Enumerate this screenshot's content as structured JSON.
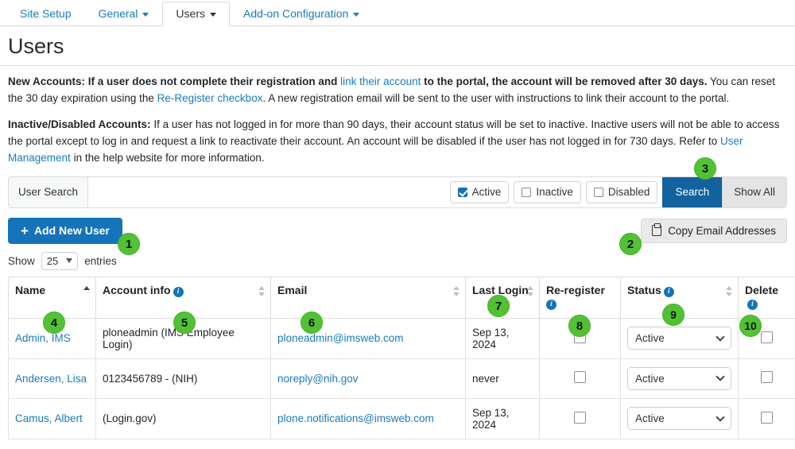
{
  "tabs": [
    {
      "label": "Site Setup",
      "has_caret": false,
      "active": false
    },
    {
      "label": "General",
      "has_caret": true,
      "active": false
    },
    {
      "label": "Users",
      "has_caret": true,
      "active": true
    },
    {
      "label": "Add-on Configuration",
      "has_caret": true,
      "active": false
    }
  ],
  "page": {
    "title": "Users"
  },
  "info": {
    "new_accounts": {
      "lead": "New Accounts:",
      "t1": " If a user does not complete their registration and ",
      "link1": "link their account",
      "t2": " to the portal, the account will be removed after 30 days.",
      "t3": " You can reset the 30 day expiration using the ",
      "link2": "Re-Register checkbox",
      "t4": ". A new registration email will be sent to the user with instructions to link their account to the portal."
    },
    "inactive_accounts": {
      "lead": "Inactive/Disabled Accounts:",
      "t1": " If a user has not logged in for more than 90 days, their account status will be set to inactive. Inactive users will not be able to access the portal except to log in and request a link to reactivate their account. An account will be disabled if the user has not logged in for 730 days. Refer to ",
      "link1": "User Management",
      "t2": " in the help website for more information."
    }
  },
  "search": {
    "label": "User Search",
    "value": "",
    "placeholder": "",
    "filters": [
      {
        "label": "Active",
        "checked": true
      },
      {
        "label": "Inactive",
        "checked": false
      },
      {
        "label": "Disabled",
        "checked": false
      }
    ],
    "search_button": "Search",
    "show_all_button": "Show All"
  },
  "actions": {
    "add_user": "Add New User",
    "add_user_plus": "+",
    "copy_emails": "Copy Email Addresses"
  },
  "show_entries": {
    "prefix": "Show",
    "value": "25",
    "suffix": "entries"
  },
  "table": {
    "columns": [
      {
        "label": "Name",
        "sort": "asc",
        "info": false
      },
      {
        "label": "Account info",
        "sort": "none",
        "info": true
      },
      {
        "label": "Email",
        "sort": "none",
        "info": false
      },
      {
        "label": "Last Login",
        "sort": "none",
        "info": false
      },
      {
        "label": "Re-register",
        "sort": "none",
        "info": true
      },
      {
        "label": "Status",
        "sort": "none",
        "info": true
      },
      {
        "label": "Delete",
        "sort": "none",
        "info": true
      }
    ],
    "rows": [
      {
        "name": "Admin, IMS",
        "account_info": "ploneadmin (IMS Employee Login)",
        "email": "ploneadmin@imsweb.com",
        "last_login": "Sep 13, 2024",
        "reregister": false,
        "status": "Active",
        "delete": false
      },
      {
        "name": "Andersen, Lisa",
        "account_info": "0123456789 - (NIH)",
        "email": "noreply@nih.gov",
        "last_login": "never",
        "reregister": false,
        "status": "Active",
        "delete": false
      },
      {
        "name": "Camus, Albert",
        "account_info": "(Login.gov)",
        "email": "plone.notifications@imsweb.com",
        "last_login": "Sep 13, 2024",
        "reregister": false,
        "status": "Active",
        "delete": false
      }
    ]
  },
  "badges": [
    {
      "n": "1"
    },
    {
      "n": "2"
    },
    {
      "n": "3"
    },
    {
      "n": "4"
    },
    {
      "n": "5"
    },
    {
      "n": "6"
    },
    {
      "n": "7"
    },
    {
      "n": "8"
    },
    {
      "n": "9"
    },
    {
      "n": "10"
    }
  ],
  "colors": {
    "primary_blue": "#1573b9",
    "search_blue": "#11629e",
    "link_blue": "#1a7bbd",
    "badge_green": "#52c234",
    "reregister_yellow": "#fcefcd",
    "delete_pink": "#f8dade"
  }
}
